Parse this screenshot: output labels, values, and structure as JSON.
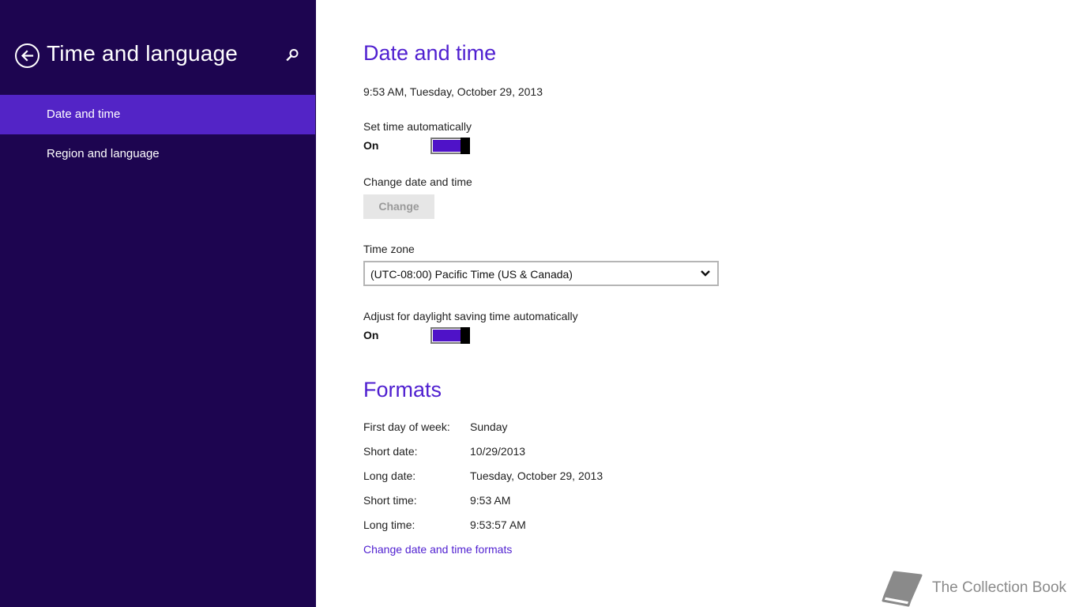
{
  "sidebar": {
    "title": "Time and language",
    "back_icon": "back-arrow-icon",
    "search_icon": "search-icon",
    "items": [
      {
        "label": "Date and time",
        "selected": true
      },
      {
        "label": "Region and language",
        "selected": false
      }
    ],
    "colors": {
      "background": "#1d0550",
      "selected": "#5324c6"
    }
  },
  "date_time": {
    "heading": "Date and time",
    "current": "9:53 AM, Tuesday, October 29, 2013",
    "set_time_auto": {
      "label": "Set time automatically",
      "state": "On"
    },
    "change_date_time": {
      "label": "Change date and time",
      "button": "Change"
    },
    "time_zone": {
      "label": "Time zone",
      "value": "(UTC-08:00) Pacific Time (US & Canada)"
    },
    "dst": {
      "label": "Adjust for daylight saving time automatically",
      "state": "On"
    }
  },
  "formats": {
    "heading": "Formats",
    "rows": [
      {
        "label": "First day of week:",
        "value": "Sunday"
      },
      {
        "label": "Short date:",
        "value": "10/29/2013"
      },
      {
        "label": "Long date:",
        "value": "Tuesday, October 29, 2013"
      },
      {
        "label": "Short time:",
        "value": "9:53 AM"
      },
      {
        "label": "Long time:",
        "value": "9:53:57 AM"
      }
    ],
    "link": "Change date and time formats"
  },
  "watermark": {
    "text": "The Collection Book",
    "icon": "book-icon"
  },
  "colors": {
    "accent": "#4f1fd0",
    "toggle_on": "#4f12c8"
  }
}
